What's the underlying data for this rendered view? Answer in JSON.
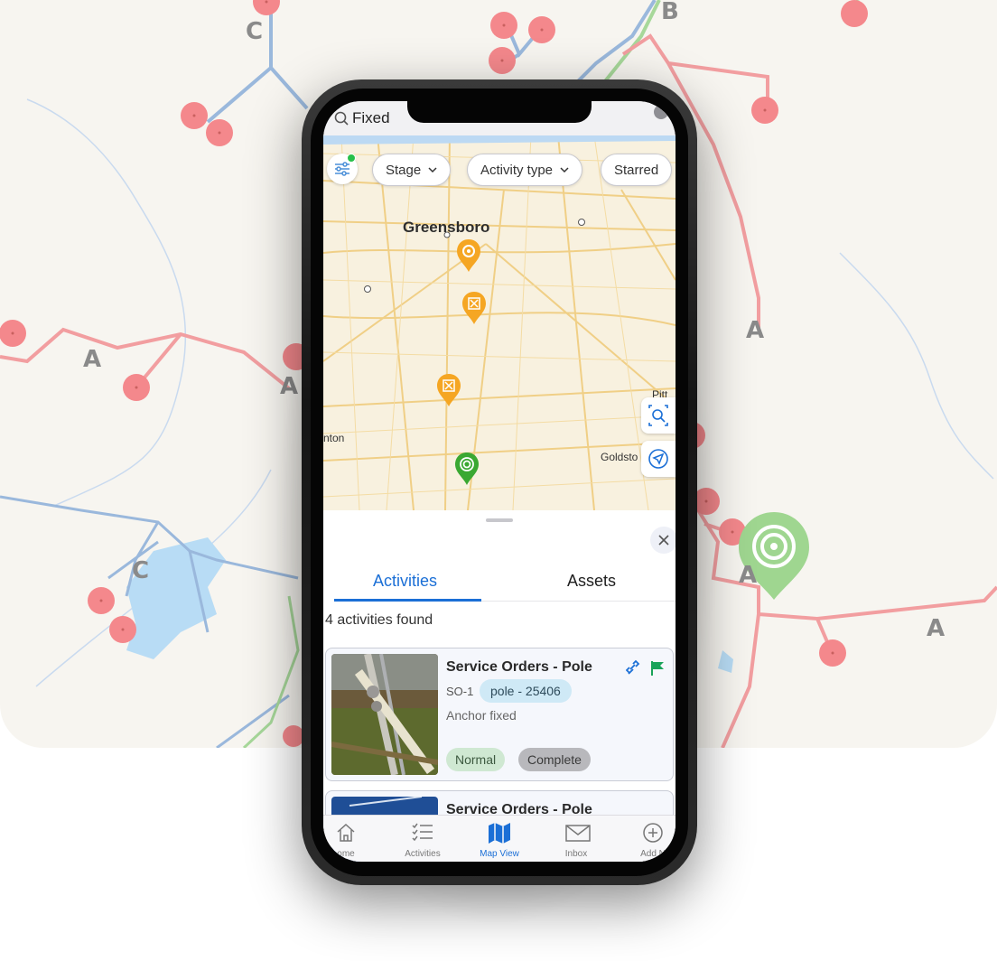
{
  "background_map": {
    "labels": [
      {
        "text": "C"
      },
      {
        "text": "B"
      },
      {
        "text": "A"
      },
      {
        "text": "A"
      },
      {
        "text": "A"
      },
      {
        "text": "C"
      },
      {
        "text": "A"
      },
      {
        "text": "A"
      }
    ]
  },
  "search": {
    "value": "Fixed"
  },
  "filters": {
    "chips": [
      {
        "label": "Stage",
        "has_chevron": true
      },
      {
        "label": "Activity type",
        "has_chevron": true
      },
      {
        "label": "Starred",
        "has_chevron": false
      }
    ]
  },
  "map": {
    "labels": {
      "city_main": "Greensboro",
      "city_left": "nton",
      "city_right": "Goldsto",
      "city_edge": "Pitt"
    },
    "pin_colors": {
      "orange": "#f5a623",
      "green": "#3aa832"
    }
  },
  "results": {
    "tabs": [
      {
        "label": "Activities",
        "active": true
      },
      {
        "label": "Assets",
        "active": false
      }
    ],
    "count_text": "4 activities found",
    "cards": [
      {
        "title": "Service Orders - Pole",
        "id": "SO-1",
        "asset_tag": "pole - 25406",
        "description": "Anchor fixed",
        "priority": "Normal",
        "status": "Complete",
        "icons": [
          "link-icon",
          "flag-icon"
        ]
      },
      {
        "title": "Service Orders - Pole"
      }
    ]
  },
  "tabbar": {
    "items": [
      {
        "label": "ome",
        "icon": "home-icon",
        "active": false
      },
      {
        "label": "Activities",
        "icon": "activities-icon",
        "active": false
      },
      {
        "label": "Map View",
        "icon": "map-icon",
        "active": true
      },
      {
        "label": "Inbox",
        "icon": "inbox-icon",
        "active": false
      },
      {
        "label": "Add N",
        "icon": "add-icon",
        "active": false
      }
    ]
  },
  "colors": {
    "accent": "#1b6fd6",
    "pole_marker": "#f4888c",
    "line_red": "#f29ea0",
    "line_blue": "#9ab8dc",
    "line_green": "#a7d89a",
    "water": "#b8dcf5",
    "big_pin": "#9fd690"
  }
}
